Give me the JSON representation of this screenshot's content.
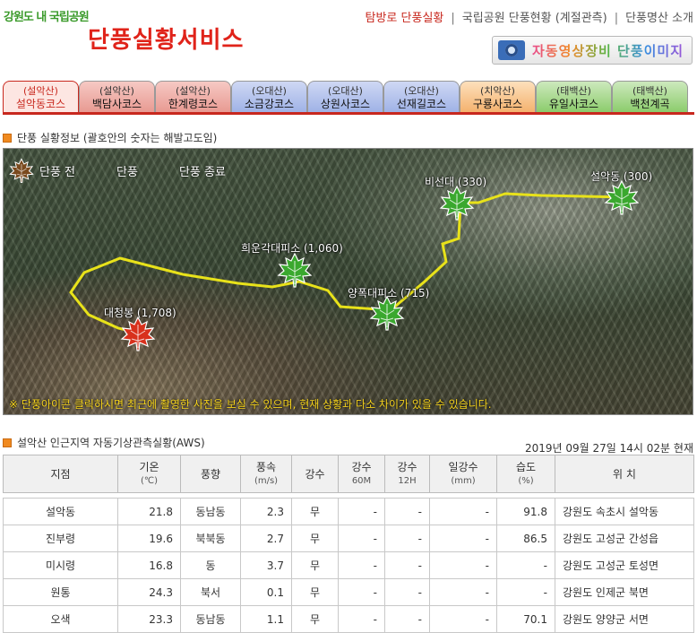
{
  "header": {
    "logo_top": "강원도 내 국립공원",
    "logo_main": "단풍실황서비스",
    "nav": [
      {
        "label": "탐방로 단풍실황",
        "active": true
      },
      {
        "label": "국립공원 단풍현황 (계절관측)",
        "active": false
      },
      {
        "label": "단풍명산 소개",
        "active": false
      }
    ],
    "camera_button": "자동영상장비 단풍이미지"
  },
  "tabs": [
    {
      "park": "(설악산)",
      "course": "설악동코스",
      "color": "red",
      "active": true
    },
    {
      "park": "(설악산)",
      "course": "백담사코스",
      "color": "red",
      "active": false
    },
    {
      "park": "(설악산)",
      "course": "한계령코스",
      "color": "red",
      "active": false
    },
    {
      "park": "(오대산)",
      "course": "소금강코스",
      "color": "blue",
      "active": false
    },
    {
      "park": "(오대산)",
      "course": "상원사코스",
      "color": "blue",
      "active": false
    },
    {
      "park": "(오대산)",
      "course": "선재길코스",
      "color": "blue",
      "active": false
    },
    {
      "park": "(치악산)",
      "course": "구룡사코스",
      "color": "orange",
      "active": false
    },
    {
      "park": "(태백산)",
      "course": "유일사코스",
      "color": "green",
      "active": false
    },
    {
      "park": "(태백산)",
      "course": "백천계곡",
      "color": "green",
      "active": false
    }
  ],
  "map_section": {
    "title": "단풍 실황정보 (괄호안의 숫자는 해발고도임)",
    "legend": [
      {
        "label": "단풍 전",
        "color": "#3aa82e"
      },
      {
        "label": "단풍",
        "color": "#d8311c"
      },
      {
        "label": "단풍 종료",
        "color": "#7a4a1e"
      }
    ],
    "points": [
      {
        "name": "비선대 (330)",
        "status": "단풍 전"
      },
      {
        "name": "설악동 (300)",
        "status": "단풍 전"
      },
      {
        "name": "희운각대피소 (1,060)",
        "status": "단풍 전"
      },
      {
        "name": "양폭대피소 (715)",
        "status": "단풍 전"
      },
      {
        "name": "대청봉 (1,708)",
        "status": "단풍"
      }
    ],
    "note": "※ 단풍아이콘 클릭하시면 최근에 촬영한 사진을 보실 수 있으며, 현재 상황과 다소 차이가 있을 수 있습니다.",
    "trail_color": "#e8e21a"
  },
  "aws_section": {
    "title": "설악산 인근지역 자동기상관측실황(AWS)",
    "timestamp": "2019년 09월 27일 14시 02분 현재",
    "headers": {
      "station": "지점",
      "temp": "기온",
      "temp_unit": "(℃)",
      "wind_dir": "풍향",
      "wind_speed": "풍속",
      "wind_speed_unit": "(m/s)",
      "precip": "강수",
      "precip60": "강수",
      "precip60_sub": "60M",
      "precip12": "강수",
      "precip12_sub": "12H",
      "daily_precip": "일강수",
      "daily_precip_unit": "(mm)",
      "humidity": "습도",
      "humidity_unit": "(%)",
      "location": "위 치"
    },
    "rows": [
      {
        "station": "설악동",
        "temp": "21.8",
        "wind_dir": "동남동",
        "wind_speed": "2.3",
        "precip": "무",
        "p60": "-",
        "p12": "-",
        "daily": "-",
        "humidity": "91.8",
        "location": "강원도 속초시 설악동"
      },
      {
        "station": "진부령",
        "temp": "19.6",
        "wind_dir": "북북동",
        "wind_speed": "2.7",
        "precip": "무",
        "p60": "-",
        "p12": "-",
        "daily": "-",
        "humidity": "86.5",
        "location": "강원도 고성군 간성읍"
      },
      {
        "station": "미시령",
        "temp": "16.8",
        "wind_dir": "동",
        "wind_speed": "3.7",
        "precip": "무",
        "p60": "-",
        "p12": "-",
        "daily": "-",
        "humidity": "-",
        "location": "강원도 고성군 토성면"
      },
      {
        "station": "원통",
        "temp": "24.3",
        "wind_dir": "북서",
        "wind_speed": "0.1",
        "precip": "무",
        "p60": "-",
        "p12": "-",
        "daily": "-",
        "humidity": "-",
        "location": "강원도 인제군 북면"
      },
      {
        "station": "오색",
        "temp": "23.3",
        "wind_dir": "동남동",
        "wind_speed": "1.1",
        "precip": "무",
        "p60": "-",
        "p12": "-",
        "daily": "-",
        "humidity": "70.1",
        "location": "강원도 양양군 서면"
      }
    ]
  }
}
